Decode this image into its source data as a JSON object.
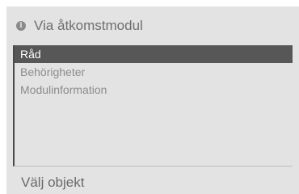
{
  "dialog": {
    "title": "Via åtkomstmodul",
    "title_icon": "info-icon"
  },
  "list": {
    "items": [
      {
        "label": "Råd",
        "selected": true
      },
      {
        "label": "Behörigheter",
        "selected": false
      },
      {
        "label": "Modulinformation",
        "selected": false
      }
    ]
  },
  "footer": {
    "hint": "Välj objekt"
  }
}
